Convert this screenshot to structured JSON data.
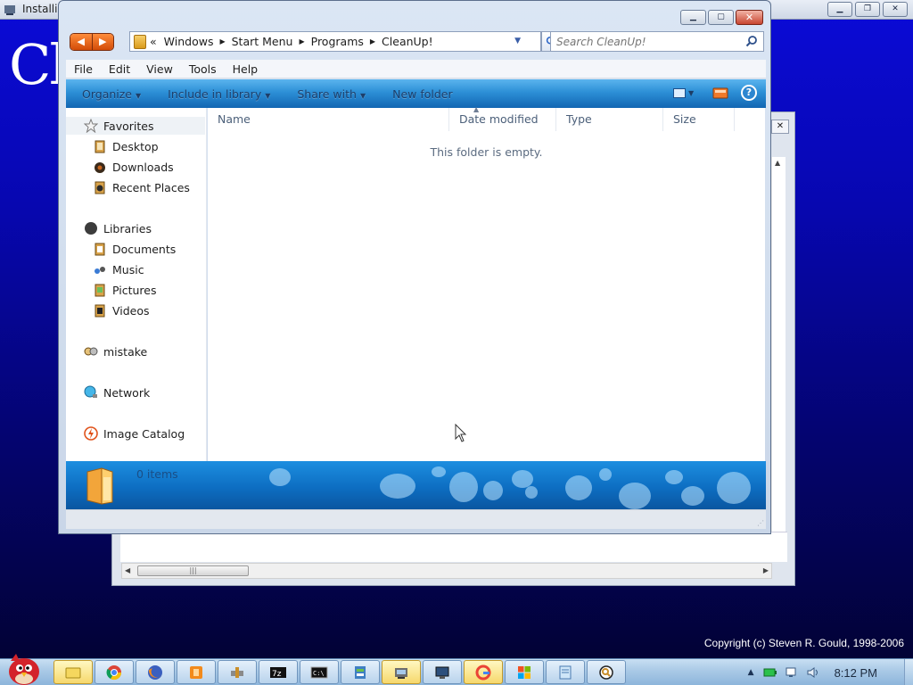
{
  "installer": {
    "title": "Installi",
    "big_text": "Cl",
    "copyright": "Copyright (c) Steven R. Gould, 1998-2006"
  },
  "explorer": {
    "breadcrumb": {
      "chevrons": "«",
      "items": [
        "Windows",
        "Start Menu",
        "Programs",
        "CleanUp!"
      ]
    },
    "search": {
      "placeholder": "Search CleanUp!"
    },
    "menu": [
      "File",
      "Edit",
      "View",
      "Tools",
      "Help"
    ],
    "toolbar": {
      "organize": "Organize",
      "include_in_library": "Include in library",
      "share_with": "Share with",
      "new_folder": "New folder"
    },
    "nav": {
      "favorites": "Favorites",
      "desktop": "Desktop",
      "downloads": "Downloads",
      "recent_places": "Recent Places",
      "libraries": "Libraries",
      "documents": "Documents",
      "music": "Music",
      "pictures": "Pictures",
      "videos": "Videos",
      "homegroup": "mistake",
      "network": "Network",
      "image_catalog": "Image Catalog"
    },
    "columns": [
      "Name",
      "Date modified",
      "Type",
      "Size"
    ],
    "empty_message": "This folder is empty.",
    "details": {
      "items_count": "0 items"
    }
  },
  "taskbar": {
    "clock": "8:12 PM"
  },
  "colors": {
    "desktop_top": "#0b0bd8",
    "toolbar_blue": "#2c8fd6",
    "nav_orange": "#e8601c"
  }
}
